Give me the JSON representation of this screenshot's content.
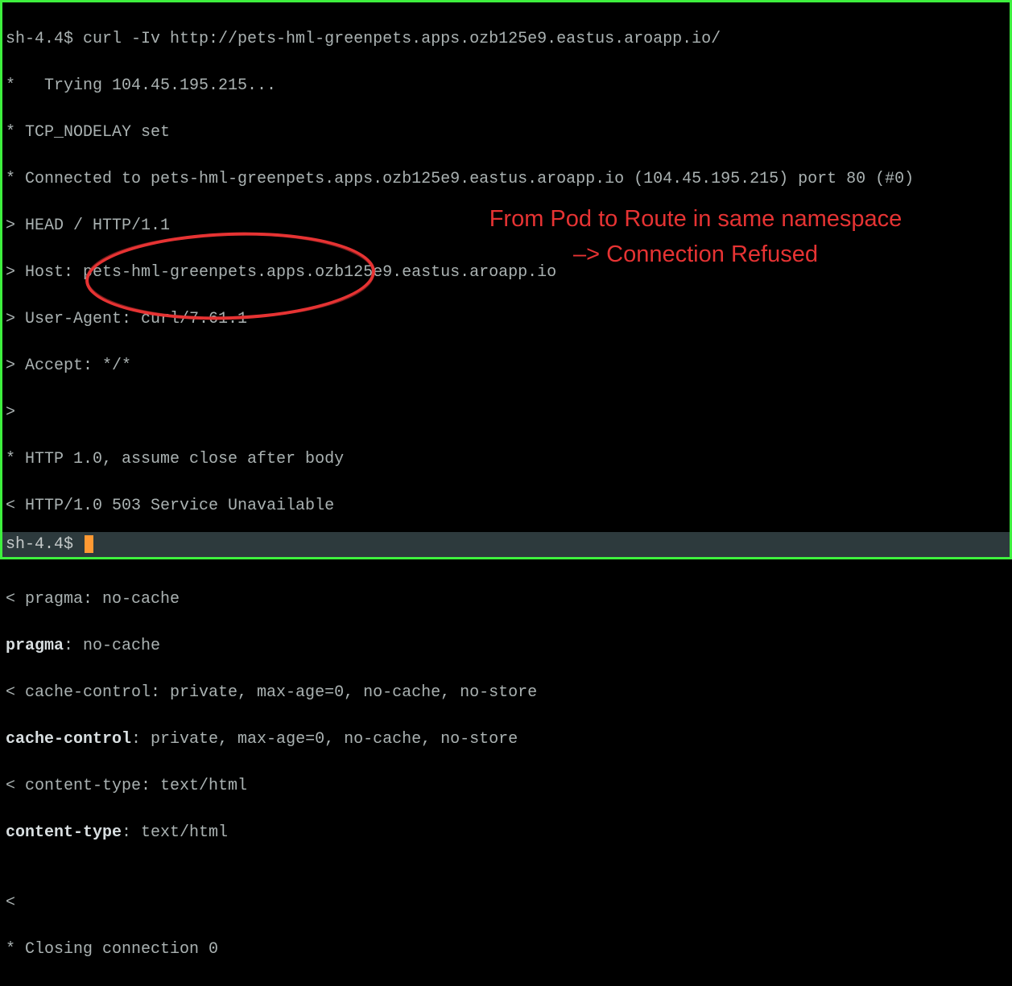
{
  "terminal": {
    "prompt1": "sh-4.4$ ",
    "command1": "curl -Iv http://pets-hml-greenpets.apps.ozb125e9.eastus.aroapp.io/",
    "lines": [
      "*   Trying 104.45.195.215...",
      "* TCP_NODELAY set",
      "* Connected to pets-hml-greenpets.apps.ozb125e9.eastus.aroapp.io (104.45.195.215) port 80 (#0)",
      "> HEAD / HTTP/1.1",
      "> Host: pets-hml-greenpets.apps.ozb125e9.eastus.aroapp.io",
      "> User-Agent: curl/7.61.1",
      "> Accept: */*",
      ">",
      "* HTTP 1.0, assume close after body",
      "< HTTP/1.0 503 Service Unavailable"
    ],
    "bold_line1": "HTTP/1.0 503 Service Unavailable",
    "lines2": [
      "< pragma: no-cache"
    ],
    "bold_pragma_label": "pragma",
    "bold_pragma_value": ": no-cache",
    "lines3": [
      "< cache-control: private, max-age=0, no-cache, no-store"
    ],
    "bold_cache_label": "cache-control",
    "bold_cache_value": ": private, max-age=0, no-cache, no-store",
    "lines4": [
      "< content-type: text/html"
    ],
    "bold_content_label": "content-type",
    "bold_content_value": ": text/html",
    "lines5": [
      "",
      "<",
      "* Closing connection 0"
    ],
    "prompt2": "sh-4.4$ "
  },
  "annotation": {
    "text": "From Pod to Route in same namespace –> Connection Refused"
  }
}
